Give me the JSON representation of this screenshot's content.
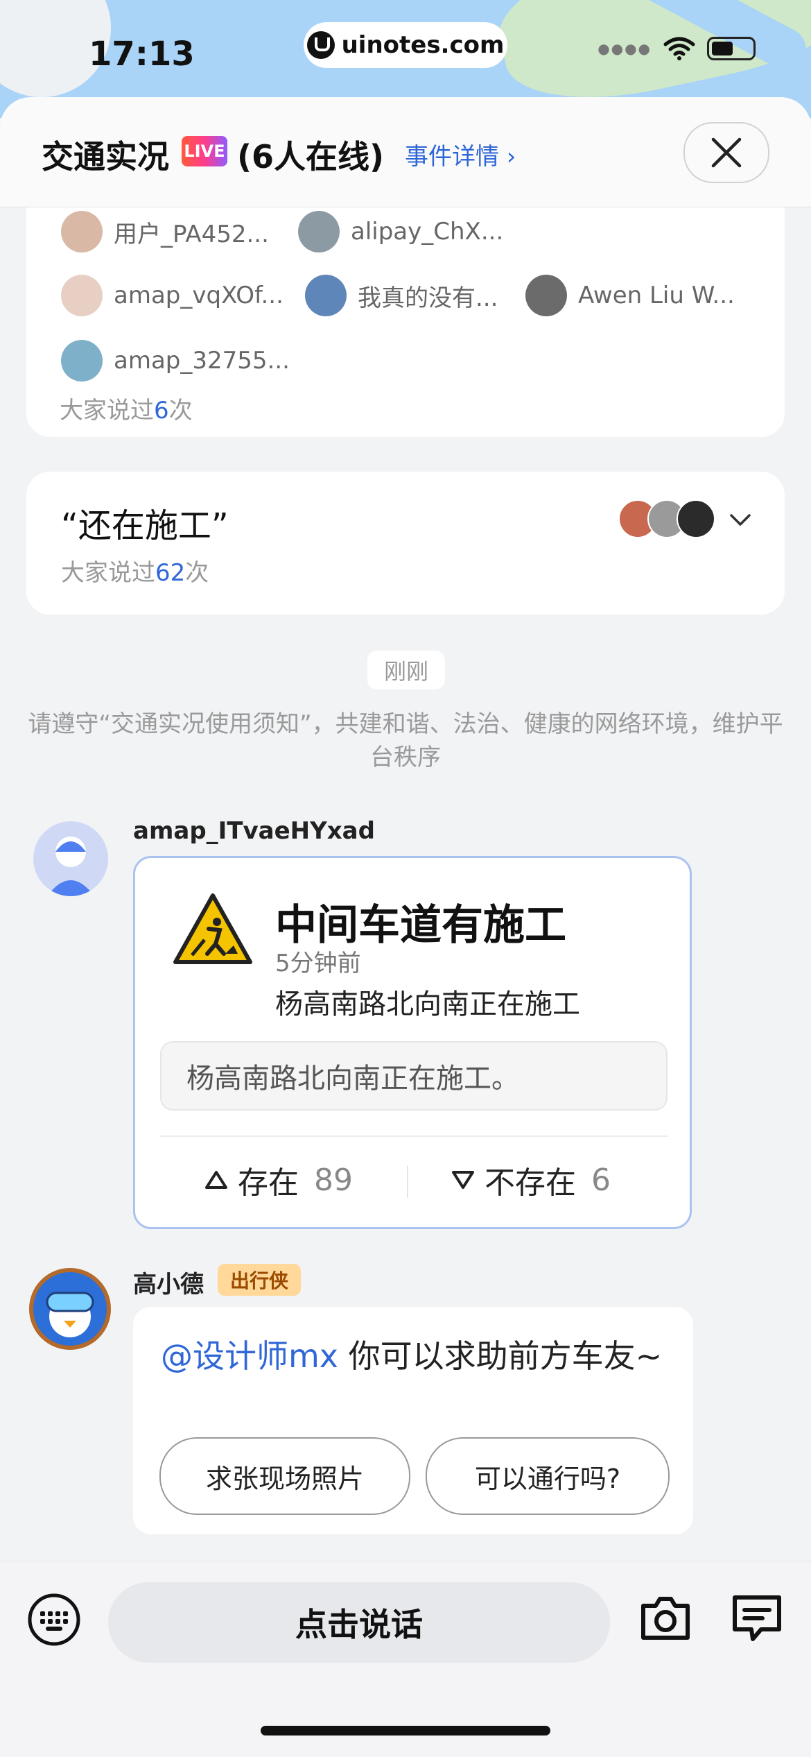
{
  "status": {
    "time": "17:13",
    "url": "uinotes.com"
  },
  "header": {
    "title": "交通实况",
    "live_badge": "LIVE",
    "online": "(6人在线)",
    "event_link": "事件详情 ›"
  },
  "card1": {
    "users": [
      {
        "name": "用户_PA452..."
      },
      {
        "name": "alipay_ChX..."
      },
      {
        "name": "amap_vqXOf..."
      },
      {
        "name": "我真的没有..."
      },
      {
        "name": "Awen Liu W..."
      },
      {
        "name": "amap_32755..."
      }
    ],
    "said_prefix": "大家说过",
    "said_count": "6",
    "said_suffix": "次"
  },
  "card2": {
    "quote": "“还在施工”",
    "said_prefix": "大家说过",
    "said_count": "62",
    "said_suffix": "次"
  },
  "time_chip": "刚刚",
  "notice": "请遵守“交通实况使用须知”，共建和谐、法治、健康的网络环境，维护平台秩序",
  "message1": {
    "author": "amap_ITvaeHYxad",
    "report": {
      "title": "中间车道有施工",
      "time": "5分钟前",
      "desc": "杨高南路北向南正在施工",
      "detail": "杨高南路北向南正在施工。",
      "exists_label": "存在",
      "exists_count": "89",
      "not_exists_label": "不存在",
      "not_exists_count": "6"
    }
  },
  "message2": {
    "author": "高小德",
    "tag": "出行侠",
    "mention": "@设计师mx",
    "text": " 你可以求助前方车友~",
    "buttons": [
      "求张现场照片",
      "可以通行吗?"
    ]
  },
  "bottom": {
    "talk_label": "点击说话"
  },
  "colors": {
    "accent": "#2f67d8",
    "card_border": "#a9c2f1",
    "tag_bg": "#ffd89a"
  }
}
